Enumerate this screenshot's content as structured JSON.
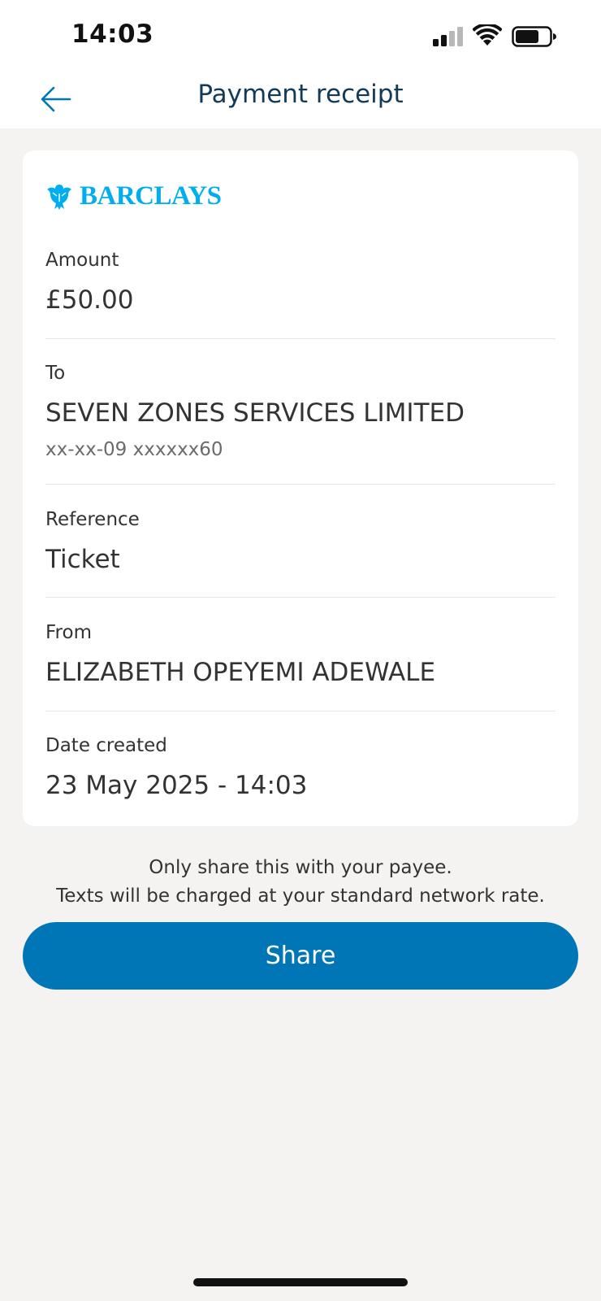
{
  "status_bar": {
    "time": "14:03",
    "icons": [
      "signal-icon",
      "wifi-icon",
      "battery-icon"
    ]
  },
  "header": {
    "title": "Payment receipt",
    "back_icon": "arrow-left-icon"
  },
  "receipt": {
    "brand": "BARCLAYS",
    "amount": {
      "label": "Amount",
      "value": "£50.00"
    },
    "to": {
      "label": "To",
      "value": "SEVEN ZONES SERVICES LIMITED",
      "account": "xx-xx-09 xxxxxx60"
    },
    "reference": {
      "label": "Reference",
      "value": "Ticket"
    },
    "from": {
      "label": "From",
      "value": "ELIZABETH OPEYEMI ADEWALE"
    },
    "date": {
      "label": "Date created",
      "value": "23 May 2025 - 14:03"
    }
  },
  "notice": {
    "line1": "Only share this with your payee.",
    "line2": "Texts will be charged at your standard network rate."
  },
  "share_button": {
    "label": "Share"
  },
  "colors": {
    "brand": "#00aeef",
    "primary_button": "#0076b6",
    "title": "#123a59",
    "background": "#f4f3f2"
  }
}
